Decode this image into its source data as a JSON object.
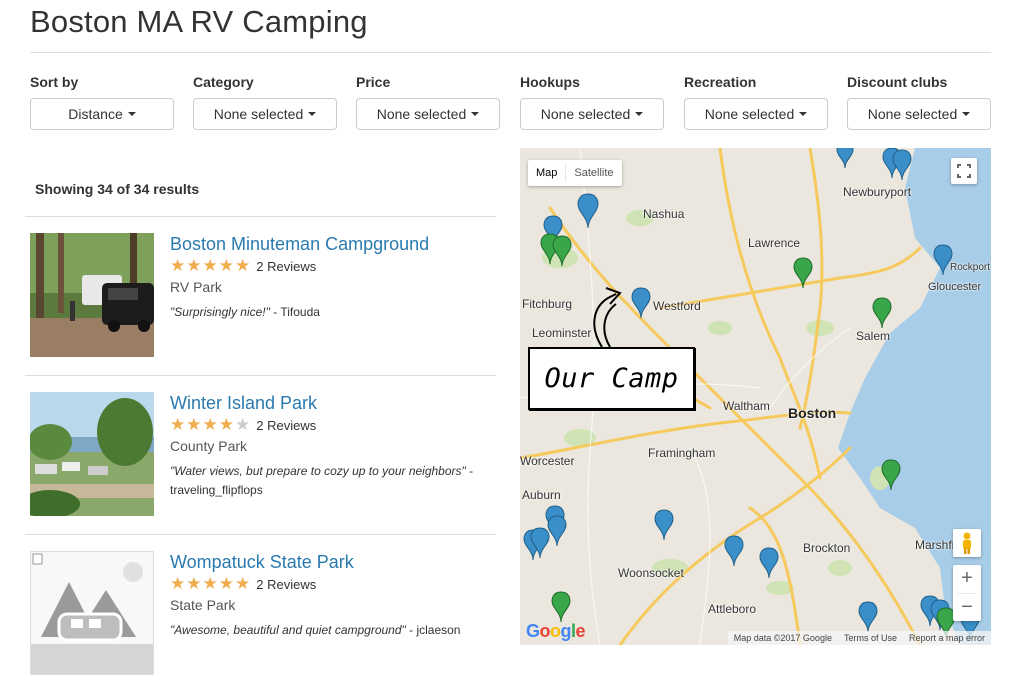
{
  "page": {
    "title": "Boston MA RV Camping"
  },
  "filters": [
    {
      "label": "Sort by",
      "value": "Distance"
    },
    {
      "label": "Category",
      "value": "None selected"
    },
    {
      "label": "Price",
      "value": "None selected"
    },
    {
      "label": "Hookups",
      "value": "None selected"
    },
    {
      "label": "Recreation",
      "value": "None selected"
    },
    {
      "label": "Discount clubs",
      "value": "None selected"
    }
  ],
  "results": {
    "count_text": "Showing 34 of 34 results"
  },
  "listings": [
    {
      "name": "Boston Minuteman Campground",
      "stars": 5,
      "reviews": "2 Reviews",
      "type": "RV Park",
      "quote": "\"Surprisingly nice!\"",
      "author": " - Tifouda"
    },
    {
      "name": "Winter Island Park",
      "stars": 4,
      "reviews": "2 Reviews",
      "type": "County Park",
      "quote": "\"Water views, but prepare to cozy up to your neighbors\"",
      "author": " - traveling_flipflops"
    },
    {
      "name": "Wompatuck State Park",
      "stars": 5,
      "reviews": "2 Reviews",
      "type": "State Park",
      "quote": "\"Awesome, beautiful and quiet campground\"",
      "author": " - jclaeson"
    }
  ],
  "map": {
    "tab_map": "Map",
    "tab_satellite": "Satellite",
    "zoom_in": "+",
    "zoom_out": "−",
    "google": "Google",
    "attribution": {
      "data": "Map data ©2017 Google",
      "terms": "Terms of Use",
      "report": "Report a map error"
    },
    "callout": "Our Camp",
    "places": {
      "nashua": "Nashua",
      "newburyport": "Newburyport",
      "lawrence": "Lawrence",
      "rockport": "Rockport",
      "gloucester": "Gloucester",
      "fitchburg": "Fitchburg",
      "westford": "Westford",
      "leominster": "Leominster",
      "salem": "Salem",
      "waltham": "Waltham",
      "boston": "Boston",
      "worcester": "Worcester",
      "framingham": "Framingham",
      "auburn": "Auburn",
      "brockton": "Brockton",
      "marshfield": "Marshfi",
      "woonsocket": "Woonsocket",
      "attleboro": "Attleboro"
    },
    "pin_colors": {
      "blue": "#3a8fc8",
      "green": "#3aa64a"
    }
  },
  "colors": {
    "link": "#2a7aaf",
    "star": "#f0ad4e",
    "water": "#a8cde8",
    "land": "#ebe7de",
    "highway": "#f6c95c"
  }
}
